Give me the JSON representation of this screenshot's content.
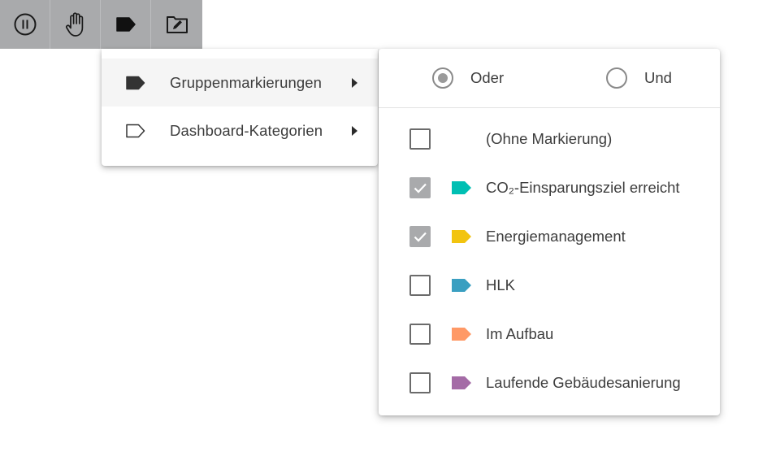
{
  "toolbar": {
    "buttons": [
      {
        "name": "pause-circle-icon"
      },
      {
        "name": "hand-icon"
      },
      {
        "name": "label-icon"
      },
      {
        "name": "folder-edit-icon"
      }
    ]
  },
  "menu": {
    "items": [
      {
        "label": "Gruppenmarkierungen",
        "icon": "label-filled-icon",
        "active": true
      },
      {
        "label": "Dashboard-Kategorien",
        "icon": "label-outline-icon",
        "active": false
      }
    ]
  },
  "submenu": {
    "radios": [
      {
        "label": "Oder",
        "selected": true
      },
      {
        "label": "Und",
        "selected": false
      }
    ],
    "options": [
      {
        "label": "(Ohne Markierung)",
        "checked": false,
        "color": ""
      },
      {
        "label": "CO₂-Einsparungsziel erreicht",
        "checked": true,
        "color": "#00bfb3"
      },
      {
        "label": "Energiemanagement",
        "checked": true,
        "color": "#f2c40f"
      },
      {
        "label": "HLK",
        "checked": false,
        "color": "#3a9fc1"
      },
      {
        "label": "Im Aufbau",
        "checked": false,
        "color": "#ff9966"
      },
      {
        "label": "Laufende Gebäudesanierung",
        "checked": false,
        "color": "#a46ba6"
      }
    ]
  },
  "colors": {
    "toolbar_bg": "#a9aaac",
    "checked_bg": "#a9aaac"
  }
}
